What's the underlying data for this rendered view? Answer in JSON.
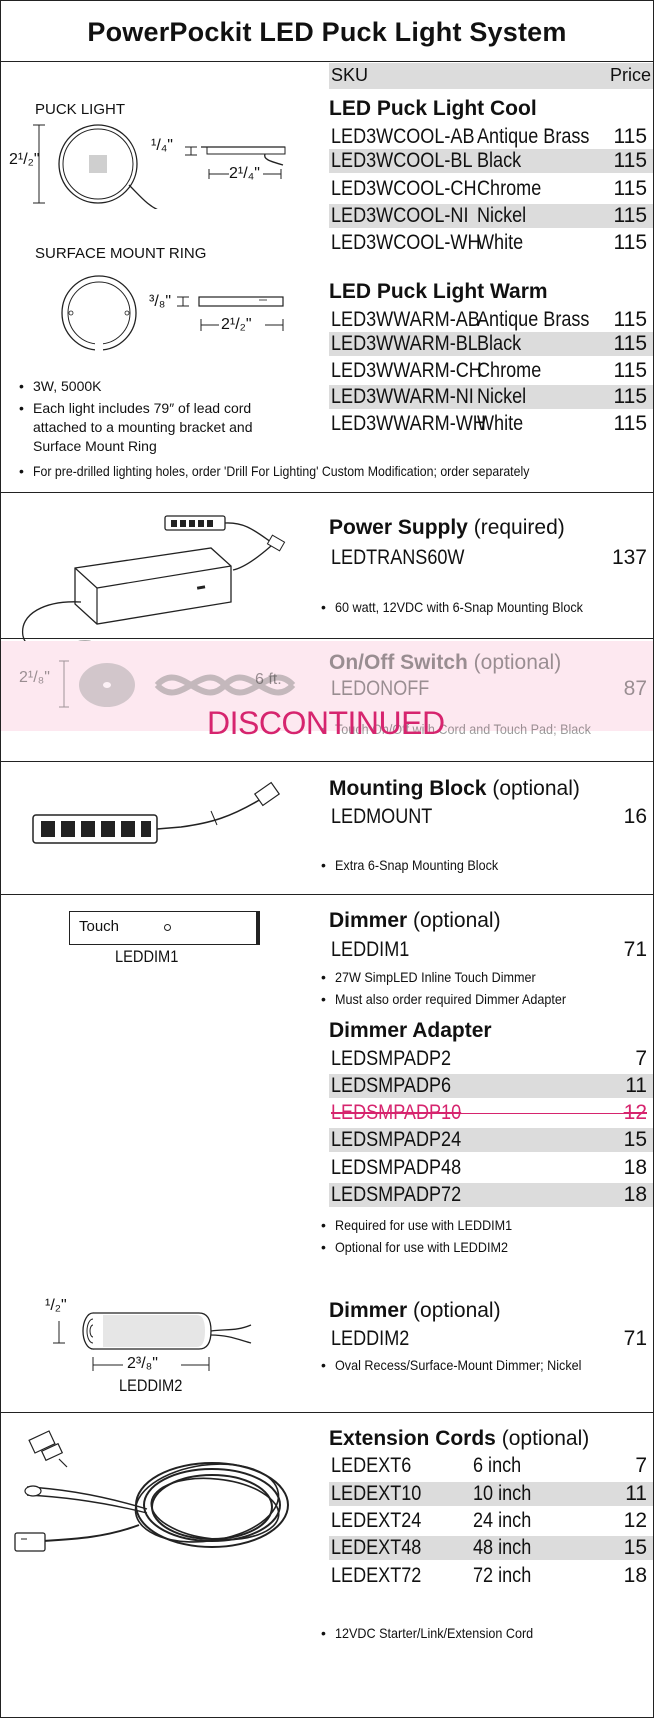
{
  "title": "PowerPockit LED Puck Light System",
  "header": {
    "sku": "SKU",
    "price": "Price"
  },
  "puck": {
    "label": "PUCK LIGHT",
    "ring_label": "SURFACE MOUNT RING",
    "dim_height": "2¹/₂\"",
    "dim_thick": "¹/₄\"",
    "dim_width": "2¹/₄\"",
    "ring_thick": "³/₈\"",
    "ring_width": "2¹/₂\"",
    "bullets": [
      "3W, 5000K",
      "Each light includes 79″ of lead cord",
      "attached to a mounting bracket and",
      "Surface Mount Ring"
    ],
    "note": "For pre-drilled lighting holes, order 'Drill For Lighting' Custom Modification; order separately"
  },
  "cool": {
    "title": "LED Puck Light Cool",
    "rows": [
      {
        "sku": "LED3WCOOL-AB",
        "desc": "Antique Brass",
        "price": "115"
      },
      {
        "sku": "LED3WCOOL-BL",
        "desc": "Black",
        "price": "115"
      },
      {
        "sku": "LED3WCOOL-CH",
        "desc": "Chrome",
        "price": "115"
      },
      {
        "sku": "LED3WCOOL-NI",
        "desc": "Nickel",
        "price": "115"
      },
      {
        "sku": "LED3WCOOL-WH",
        "desc": "White",
        "price": "115"
      }
    ]
  },
  "warm": {
    "title": "LED Puck Light Warm",
    "rows": [
      {
        "sku": "LED3WWARM-AB",
        "desc": "Antique Brass",
        "price": "115"
      },
      {
        "sku": "LED3WWARM-BL",
        "desc": "Black",
        "price": "115"
      },
      {
        "sku": "LED3WWARM-CH",
        "desc": "Chrome",
        "price": "115"
      },
      {
        "sku": "LED3WWARM-NI",
        "desc": "Nickel",
        "price": "115"
      },
      {
        "sku": "LED3WWARM-WH",
        "desc": "White",
        "price": "115"
      }
    ]
  },
  "power": {
    "title": "Power Supply",
    "qualifier": "(required)",
    "sku": "LEDTRANS60W",
    "price": "137",
    "bullet": "60 watt, 12VDC with 6-Snap Mounting Block"
  },
  "onoff": {
    "title": "On/Off Switch",
    "qualifier": "(optional)",
    "sku": "LEDONOFF",
    "price": "87",
    "bullet": "Touch On/Off with Cord and Touch Pad; Black",
    "dim_height": "2¹/₈\"",
    "cord_len": "6 ft.",
    "stamp": "DISCONTINUED",
    "stamp_color": "#d6246e"
  },
  "mount": {
    "title": "Mounting Block",
    "qualifier": "(optional)",
    "sku": "LEDMOUNT",
    "price": "16",
    "bullet": "Extra 6-Snap Mounting Block"
  },
  "dimmer1": {
    "title": "Dimmer",
    "qualifier": "(optional)",
    "sku": "LEDDIM1",
    "price": "71",
    "device_text": "Touch",
    "caption": "LEDDIM1",
    "bullets": [
      "27W SimpLED Inline Touch Dimmer",
      "Must also order required Dimmer Adapter"
    ]
  },
  "adapter": {
    "title": "Dimmer Adapter",
    "rows": [
      {
        "sku": "LEDSMPADP2",
        "price": "7"
      },
      {
        "sku": "LEDSMPADP6",
        "price": "11"
      },
      {
        "sku": "LEDSMPADP10",
        "price": "12"
      },
      {
        "sku": "LEDSMPADP24",
        "price": "15"
      },
      {
        "sku": "LEDSMPADP48",
        "price": "18"
      },
      {
        "sku": "LEDSMPADP72",
        "price": "18"
      }
    ],
    "bullets": [
      "Required for use with LEDDIM1",
      "Optional for use with LEDDIM2"
    ]
  },
  "dimmer2": {
    "title": "Dimmer",
    "qualifier": "(optional)",
    "sku": "LEDDIM2",
    "price": "71",
    "bullet": "Oval Recess/Surface-Mount Dimmer; Nickel",
    "caption": "LEDDIM2",
    "dim_height": "¹/₂\"",
    "dim_len": "2³/₈\""
  },
  "ext": {
    "title": "Extension Cords",
    "qualifier": "(optional)",
    "rows": [
      {
        "sku": "LEDEXT6",
        "desc": "6 inch",
        "price": "7"
      },
      {
        "sku": "LEDEXT10",
        "desc": "10 inch",
        "price": "11"
      },
      {
        "sku": "LEDEXT24",
        "desc": "24 inch",
        "price": "12"
      },
      {
        "sku": "LEDEXT48",
        "desc": "48 inch",
        "price": "15"
      },
      {
        "sku": "LEDEXT72",
        "desc": "72 inch",
        "price": "18"
      }
    ],
    "bullet": "12VDC Starter/Link/Extension Cord"
  }
}
